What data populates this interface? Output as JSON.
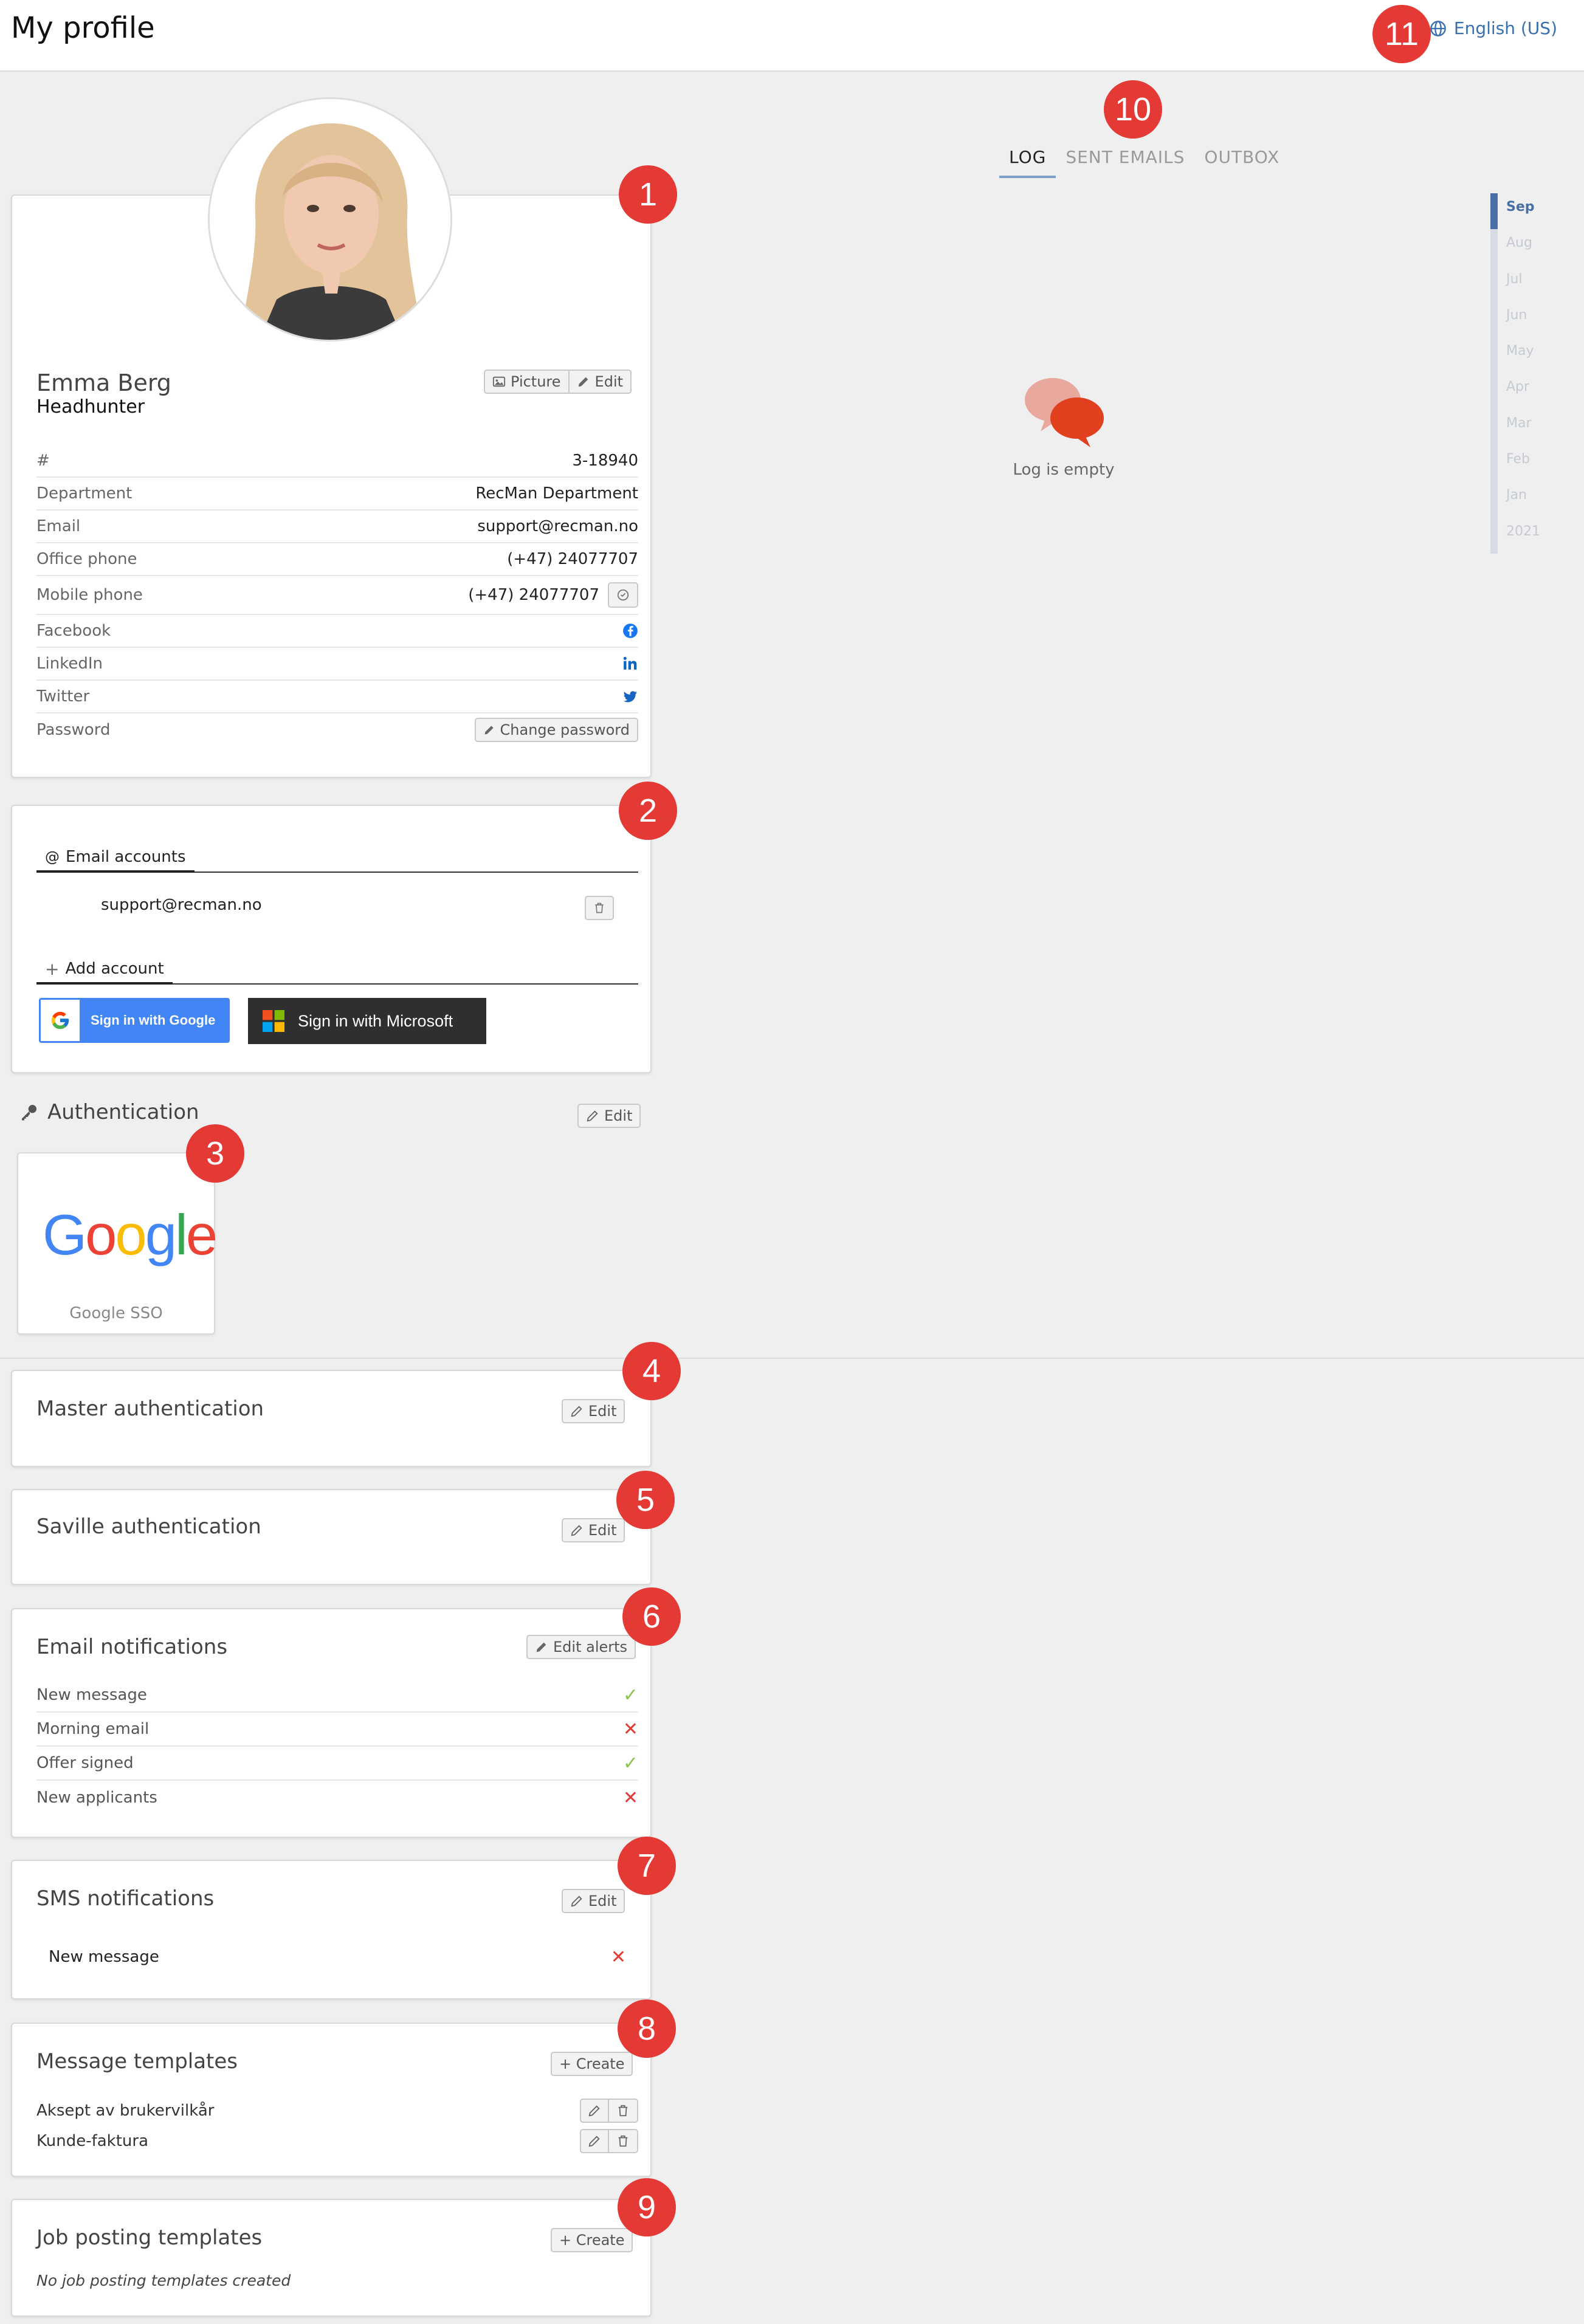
{
  "header": {
    "title": "My profile",
    "language": "English (US)"
  },
  "badges": [
    "1",
    "2",
    "3",
    "4",
    "5",
    "6",
    "7",
    "8",
    "9",
    "10",
    "11"
  ],
  "profile": {
    "name": "Emma Berg",
    "role": "Headhunter",
    "picture_label": "Picture",
    "edit_label": "Edit",
    "rows": [
      {
        "label": "#",
        "value": "3-18940"
      },
      {
        "label": "Department",
        "value": "RecMan Department"
      },
      {
        "label": "Email",
        "value": "support@recman.no"
      },
      {
        "label": "Office phone",
        "value": "(+47) 24077707"
      },
      {
        "label": "Mobile phone",
        "value": "(+47) 24077707"
      },
      {
        "label": "Facebook",
        "value": ""
      },
      {
        "label": "LinkedIn",
        "value": ""
      },
      {
        "label": "Twitter",
        "value": ""
      },
      {
        "label": "Password",
        "value": ""
      }
    ],
    "change_password_label": "Change password"
  },
  "email_accounts": {
    "title": "Email accounts",
    "account": "support@recman.no",
    "add_label": "Add account",
    "google_label": "Sign in with Google",
    "microsoft_label": "Sign in with Microsoft"
  },
  "authentication": {
    "title": "Authentication",
    "edit_label": "Edit",
    "sso_label": "Google SSO",
    "logo_text": "Google"
  },
  "master_auth": {
    "title": "Master authentication",
    "edit_label": "Edit"
  },
  "saville_auth": {
    "title": "Saville authentication",
    "edit_label": "Edit"
  },
  "email_notifications": {
    "title": "Email notifications",
    "edit_label": "Edit alerts",
    "rows": [
      {
        "label": "New message",
        "enabled": true
      },
      {
        "label": "Morning email",
        "enabled": false
      },
      {
        "label": "Offer signed",
        "enabled": true
      },
      {
        "label": "New applicants",
        "enabled": false
      }
    ]
  },
  "sms_notifications": {
    "title": "SMS notifications",
    "edit_label": "Edit",
    "rows": [
      {
        "label": "New message",
        "enabled": false
      }
    ]
  },
  "message_templates": {
    "title": "Message templates",
    "create_label": "+ Create",
    "items": [
      "Aksept av brukervilkår",
      "Kunde-faktura"
    ]
  },
  "job_posting_templates": {
    "title": "Job posting templates",
    "create_label": "+ Create",
    "empty_text": "No job posting templates created"
  },
  "log": {
    "tabs": [
      "LOG",
      "SENT EMAILS",
      "OUTBOX"
    ],
    "active_tab": "LOG",
    "empty_text": "Log is empty",
    "timeline": [
      "Sep",
      "Aug",
      "Jul",
      "Jun",
      "May",
      "Apr",
      "Mar",
      "Feb",
      "Jan",
      "2021"
    ]
  },
  "colors": {
    "badge": "#e53935",
    "accent": "#4a6fa5",
    "ok": "#8bc34a",
    "no": "#e53935"
  }
}
